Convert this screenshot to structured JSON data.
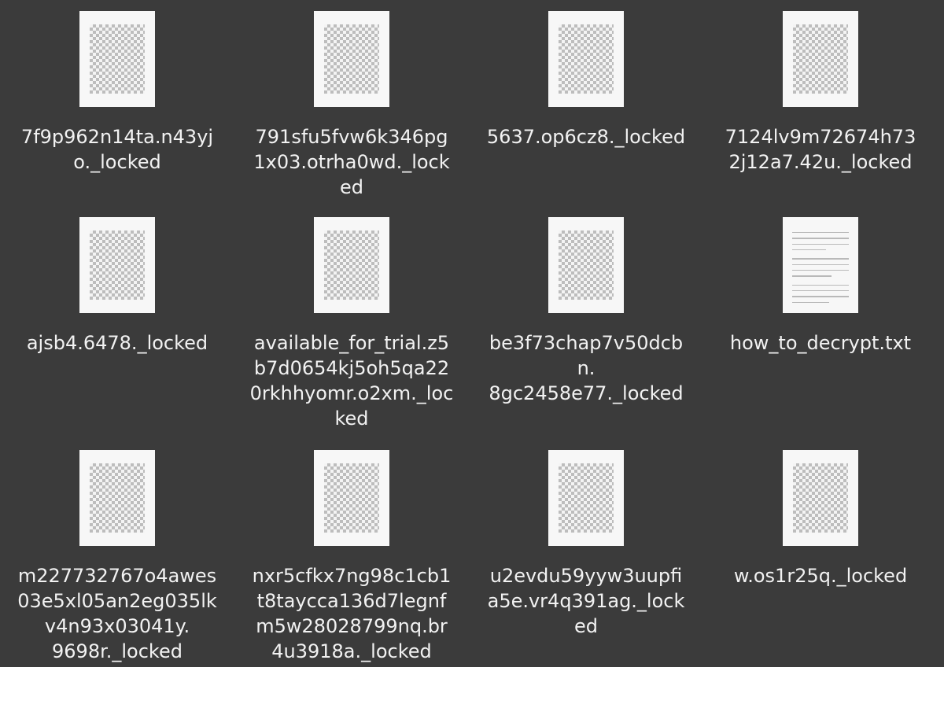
{
  "files": [
    {
      "name": "7f9p962n14ta.n43yj\no._locked",
      "icon": "image-placeholder-icon"
    },
    {
      "name": "791sfu5fvw6k346pg\n1x03.otrha0wd._lock\ned",
      "icon": "image-placeholder-icon"
    },
    {
      "name": "5637.op6cz8._locked",
      "icon": "image-placeholder-icon"
    },
    {
      "name": "7124lv9m72674h73\n2j12a7.42u._locked",
      "icon": "image-placeholder-icon"
    },
    {
      "name": "ajsb4.6478._locked",
      "icon": "image-placeholder-icon"
    },
    {
      "name": "available_for_trial.z5\nb7d0654kj5oh5qa22\n0rkhhyomr.o2xm._loc\nked",
      "icon": "image-placeholder-icon"
    },
    {
      "name": "be3f73chap7v50dcb\nn.\n8gc2458e77._locked",
      "icon": "image-placeholder-icon"
    },
    {
      "name": "how_to_decrypt.txt",
      "icon": "text-document-icon"
    },
    {
      "name": "m227732767o4awes\n03e5xl05an2eg035lk\nv4n93x03041y.\n9698r._locked",
      "icon": "image-placeholder-icon"
    },
    {
      "name": "nxr5cfkx7ng98c1cb1\nt8taycca136d7legnf\nm5w28028799nq.br\n4u3918a._locked",
      "icon": "image-placeholder-icon"
    },
    {
      "name": "u2evdu59yyw3uupfi\na5e.vr4q391ag._lock\ned",
      "icon": "image-placeholder-icon"
    },
    {
      "name": "w.os1r25q._locked",
      "icon": "image-placeholder-icon"
    }
  ],
  "colors": {
    "panel_background": "#3b3b3b",
    "label_text": "#f2f2f2",
    "icon_page": "#f7f7f7"
  }
}
